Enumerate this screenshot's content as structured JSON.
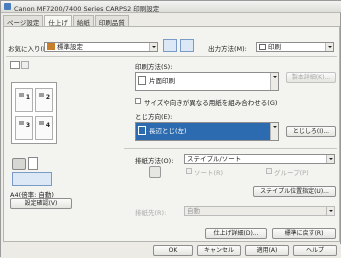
{
  "window": {
    "title": "Canon MF7200/7400 Series CARPS2 印刷設定"
  },
  "tabs": [
    "ページ設定",
    "仕上げ",
    "給紙",
    "印刷品質"
  ],
  "favorites": {
    "label": "お気に入り(F):",
    "value": "標準設定"
  },
  "output_method": {
    "label": "出力方法(M):",
    "value": "印刷"
  },
  "print_style": {
    "label": "印刷方法(S):",
    "value": "片面印刷",
    "button": "製本詳細(K)..."
  },
  "mixed_sizes": {
    "label": "サイズや向きが異なる用紙を組み合わせる(G)"
  },
  "binding": {
    "label": "とじ方向(E):",
    "value": "長辺とじ(左)",
    "button": "とじしろ(I)..."
  },
  "preview": {
    "pages": [
      "1",
      "2",
      "3",
      "4"
    ],
    "caption": "A4(倍率: 自動)",
    "settings_button": "設定確認(V)"
  },
  "finishing": {
    "label": "排紙方法(O):",
    "value": "ステイプル/ソート",
    "opt1": "ソート(R)",
    "opt2": "グループ(P)",
    "staple_button": "ステイプル位置指定(U)..."
  },
  "output_tray": {
    "label": "排紙先(R):",
    "value": "自動"
  },
  "detail_button": "仕上げ詳細(D)...",
  "restore_button": "標準に戻す(R)",
  "bottom": {
    "ok": "OK",
    "cancel": "キャンセル",
    "apply": "適用(A)",
    "help": "ヘルプ"
  },
  "colors": {
    "selected_bg": "#2d6bb0",
    "accent": "#4a7cc0"
  }
}
